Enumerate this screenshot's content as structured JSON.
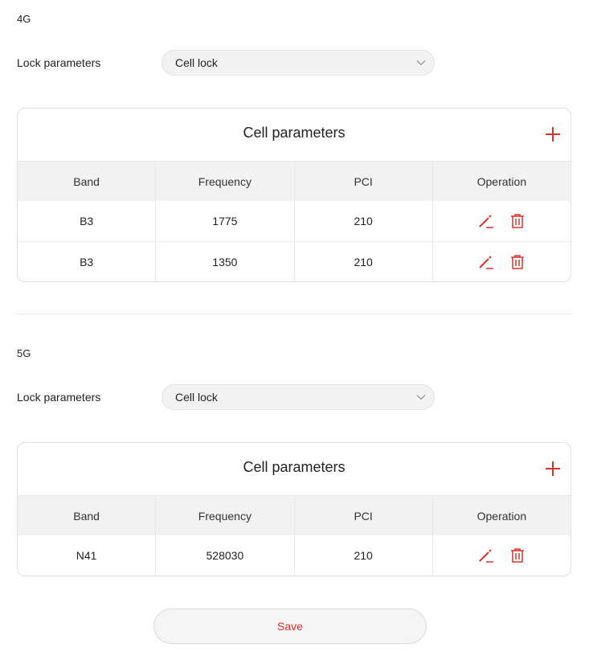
{
  "colors": {
    "accent": "#d9322e",
    "header_bg": "#f2f2f2",
    "border": "#e0e0e0"
  },
  "lte": {
    "section_title": "4G",
    "lock_label": "Lock parameters",
    "lock_value": "Cell lock",
    "card_title": "Cell parameters",
    "add_icon": "plus-icon",
    "columns": [
      "Band",
      "Frequency",
      "PCI",
      "Operation"
    ],
    "rows": [
      {
        "band": "B3",
        "frequency": "1775",
        "pci": "210"
      },
      {
        "band": "B3",
        "frequency": "1350",
        "pci": "210"
      }
    ]
  },
  "nr": {
    "section_title": "5G",
    "lock_label": "Lock parameters",
    "lock_value": "Cell lock",
    "card_title": "Cell parameters",
    "add_icon": "plus-icon",
    "columns": [
      "Band",
      "Frequency",
      "PCI",
      "Operation"
    ],
    "rows": [
      {
        "band": "N41",
        "frequency": "528030",
        "pci": "210"
      }
    ]
  },
  "icons": {
    "edit": "edit-pencil-icon",
    "delete": "trash-icon",
    "dropdown": "chevron-down-icon"
  },
  "save_label": "Save"
}
